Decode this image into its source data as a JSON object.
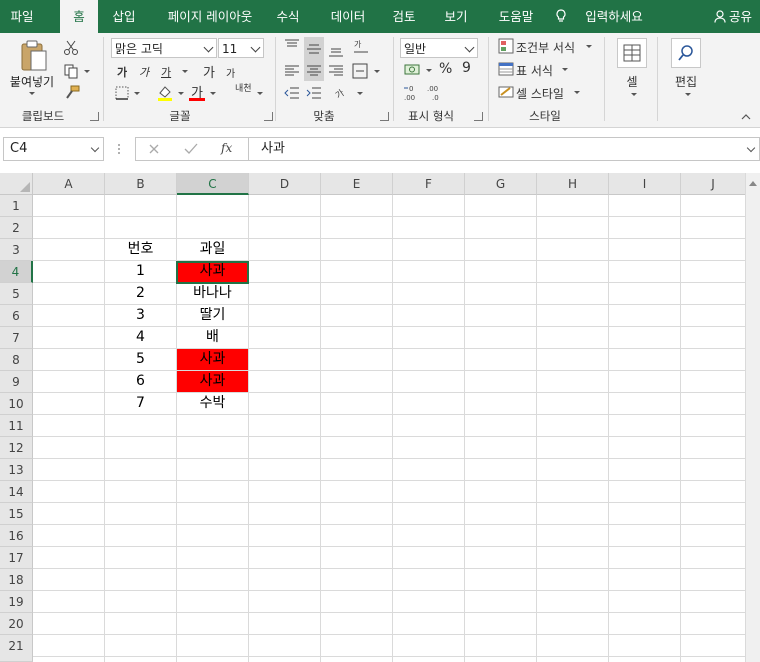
{
  "tabs": [
    "파일",
    "홈",
    "삽입",
    "페이지 레이아웃",
    "수식",
    "데이터",
    "검토",
    "보기",
    "도움말"
  ],
  "active_tab": "홈",
  "tell_me": "입력하세요",
  "share": "공유",
  "ribbon": {
    "clipboard": {
      "paste": "붙여넣기",
      "label": "클립보드"
    },
    "font": {
      "name": "맑은 고딕",
      "size": "11",
      "label": "글꼴",
      "bold": "가",
      "italic": "가",
      "underline": "가",
      "grow": "가",
      "shrink": "가",
      "fontcolor": "가",
      "phonetic": "내천"
    },
    "alignment": {
      "label": "맞춤"
    },
    "number": {
      "format": "일반",
      "percent": "%",
      "comma": "9",
      "label": "표시 형식"
    },
    "styles": {
      "conditional": "조건부 서식",
      "table": "표 서식",
      "cell": "셀 스타일",
      "label": "스타일"
    },
    "cells": {
      "label": "셀"
    },
    "editing": {
      "label": "편집"
    }
  },
  "formula_bar": {
    "name_box": "C4",
    "fx": "fx",
    "value": "사과"
  },
  "columns": [
    "A",
    "B",
    "C",
    "D",
    "E",
    "F",
    "G",
    "H",
    "I",
    "J"
  ],
  "rows": [
    "1",
    "2",
    "3",
    "4",
    "5",
    "6",
    "7",
    "8",
    "9",
    "10",
    "11",
    "12",
    "13",
    "14",
    "15",
    "16",
    "17",
    "18",
    "19",
    "20",
    "21"
  ],
  "table": {
    "header": {
      "b": "번호",
      "c": "과일"
    },
    "rows": [
      {
        "b": "1",
        "c": "사과"
      },
      {
        "b": "2",
        "c": "바나나"
      },
      {
        "b": "3",
        "c": "딸기"
      },
      {
        "b": "4",
        "c": "배"
      },
      {
        "b": "5",
        "c": "사과"
      },
      {
        "b": "6",
        "c": "사과"
      },
      {
        "b": "7",
        "c": "수박"
      }
    ]
  },
  "colors": {
    "accent": "#217346",
    "highlight": "#ff0000"
  }
}
